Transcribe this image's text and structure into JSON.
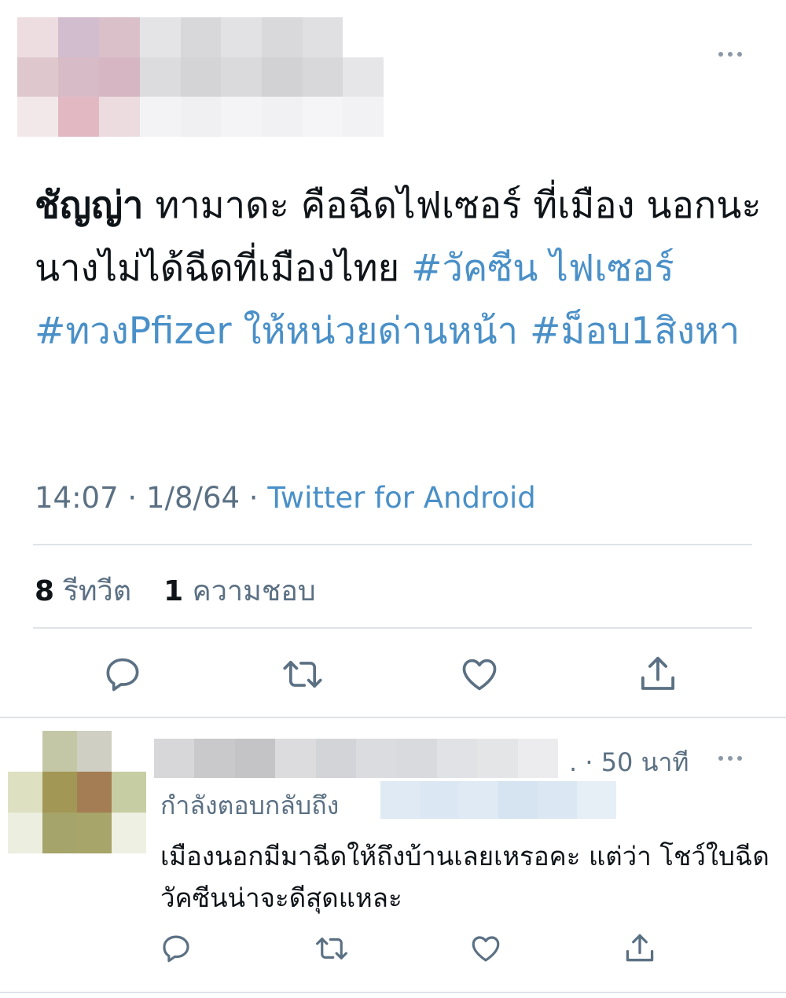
{
  "tweet": {
    "author_name": "ชัญญ่า",
    "text_body": "ทามาดะ คือฉีดไฟเซอร์ ที่เมือง นอกนะ นางไม่ได้ฉีดที่เมืองไทย",
    "hashtags": [
      "#วัคซีน ไฟเซอร์",
      "#ทวงPfizer ให้หน่วยด่านหน้า",
      "#ม็อบ1สิงหา"
    ],
    "time": "14:07",
    "date": "1/8/64",
    "source": "Twitter for Android",
    "retweet_count": "8",
    "retweet_label": "รีทวีต",
    "like_count": "1",
    "like_label": "ความชอบ"
  },
  "reply": {
    "time_ago": "50 นาที",
    "replying_to_label": "กำลังตอบกลับถึง",
    "text": "เมืองนอกมีมาฉีดให้ถึงบ้านเลยเหรอคะ แต่ว่า โชว์ใบฉีดวัคซีนน่าจะดีสุดแหละ"
  },
  "icons": {
    "reply": "reply-icon",
    "retweet": "retweet-icon",
    "like": "heart-icon",
    "share": "share-icon",
    "more": "more-icon"
  },
  "colors": {
    "link": "#4a90c8",
    "secondary_text": "#5b7083",
    "icon": "#5b7083"
  }
}
